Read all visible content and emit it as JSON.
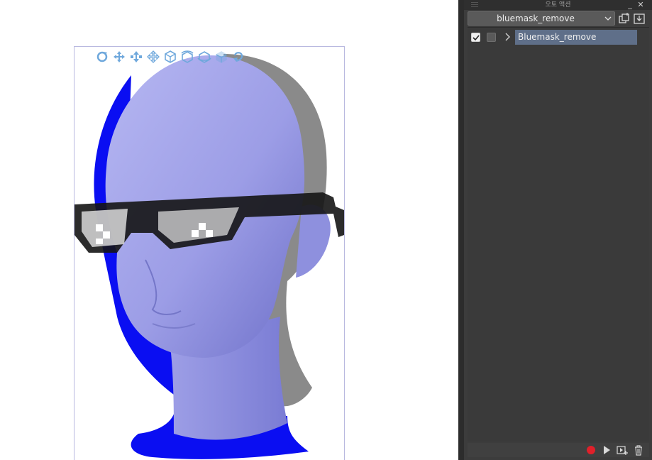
{
  "panel": {
    "title": "오토 액션",
    "minimize_glyph": "_",
    "close_glyph": "✕",
    "set_selector": {
      "selected": "bluemask_remove",
      "icon": "chevron-down-icon"
    },
    "set_buttons": [
      {
        "name": "new-set-icon"
      },
      {
        "name": "import-set-icon"
      }
    ],
    "actions": [
      {
        "label": "Bluemask_remove",
        "enabled": true,
        "dialog": false,
        "expanded": false
      }
    ],
    "bottom_buttons": [
      {
        "name": "record-icon",
        "color": "#e0202a"
      },
      {
        "name": "play-icon"
      },
      {
        "name": "add-command-icon"
      },
      {
        "name": "delete-icon"
      }
    ]
  },
  "canvas": {
    "model_toolbar": [
      "rotate-camera-icon",
      "pan-camera-icon",
      "dolly-camera-icon",
      "move-object-icon",
      "rotate-object-icon",
      "rotate-object-y-icon",
      "rotate-object-x-icon",
      "move-on-plane-icon",
      "reset-angle-icon"
    ],
    "colors": {
      "model_fill": "#9fa0e8",
      "mask_blue": "#0a0ef2",
      "shadow_gray": "#8a8a8a",
      "glasses_black": "#151515",
      "icon_blue": "#6fa8dc",
      "doc_border": "#b9b9e0"
    }
  }
}
